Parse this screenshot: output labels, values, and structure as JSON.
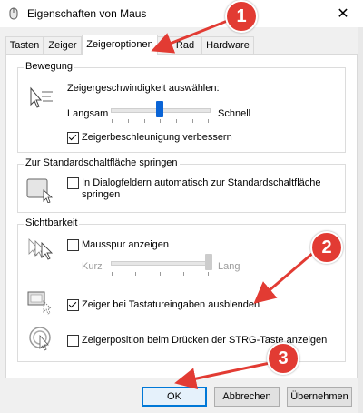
{
  "window": {
    "title": "Eigenschaften von Maus",
    "close_glyph": "✕"
  },
  "tabs": [
    {
      "label": "Tasten"
    },
    {
      "label": "Zeiger"
    },
    {
      "label": "Zeigeroptionen"
    },
    {
      "label": "Rad"
    },
    {
      "label": "Hardware"
    }
  ],
  "active_tab": "Zeigeroptionen",
  "bewegung": {
    "label": "Bewegung",
    "speed_label": "Zeigergeschwindigkeit auswählen:",
    "slow": "Langsam",
    "fast": "Schnell",
    "speed_value": 0.5,
    "accel_label": "Zeigerbeschleunigung verbessern",
    "accel_checked": true
  },
  "snap": {
    "label": "Zur Standardschaltfläche springen",
    "checkbox_label_line1": "In Dialogfeldern automatisch zur Standardschaltfläche",
    "checkbox_label_line2": "springen",
    "checked": false
  },
  "sichtbarkeit": {
    "label": "Sichtbarkeit",
    "trail_label": "Mausspur anzeigen",
    "trail_checked": false,
    "short": "Kurz",
    "long": "Lang",
    "trail_value": 1.0,
    "hide_label": "Zeiger bei Tastatureingaben ausblenden",
    "hide_checked": true,
    "ctrl_label": "Zeigerposition beim Drücken der STRG-Taste anzeigen",
    "ctrl_checked": false
  },
  "buttons": {
    "ok": "OK",
    "cancel": "Abbrechen",
    "apply": "Übernehmen"
  },
  "annotations": {
    "badge1": "1",
    "badge2": "2",
    "badge3": "3",
    "color": "#e23b33"
  },
  "colors": {
    "accent": "#0a64d6",
    "panel": "#ffffff",
    "dialog": "#f0f0f0"
  }
}
